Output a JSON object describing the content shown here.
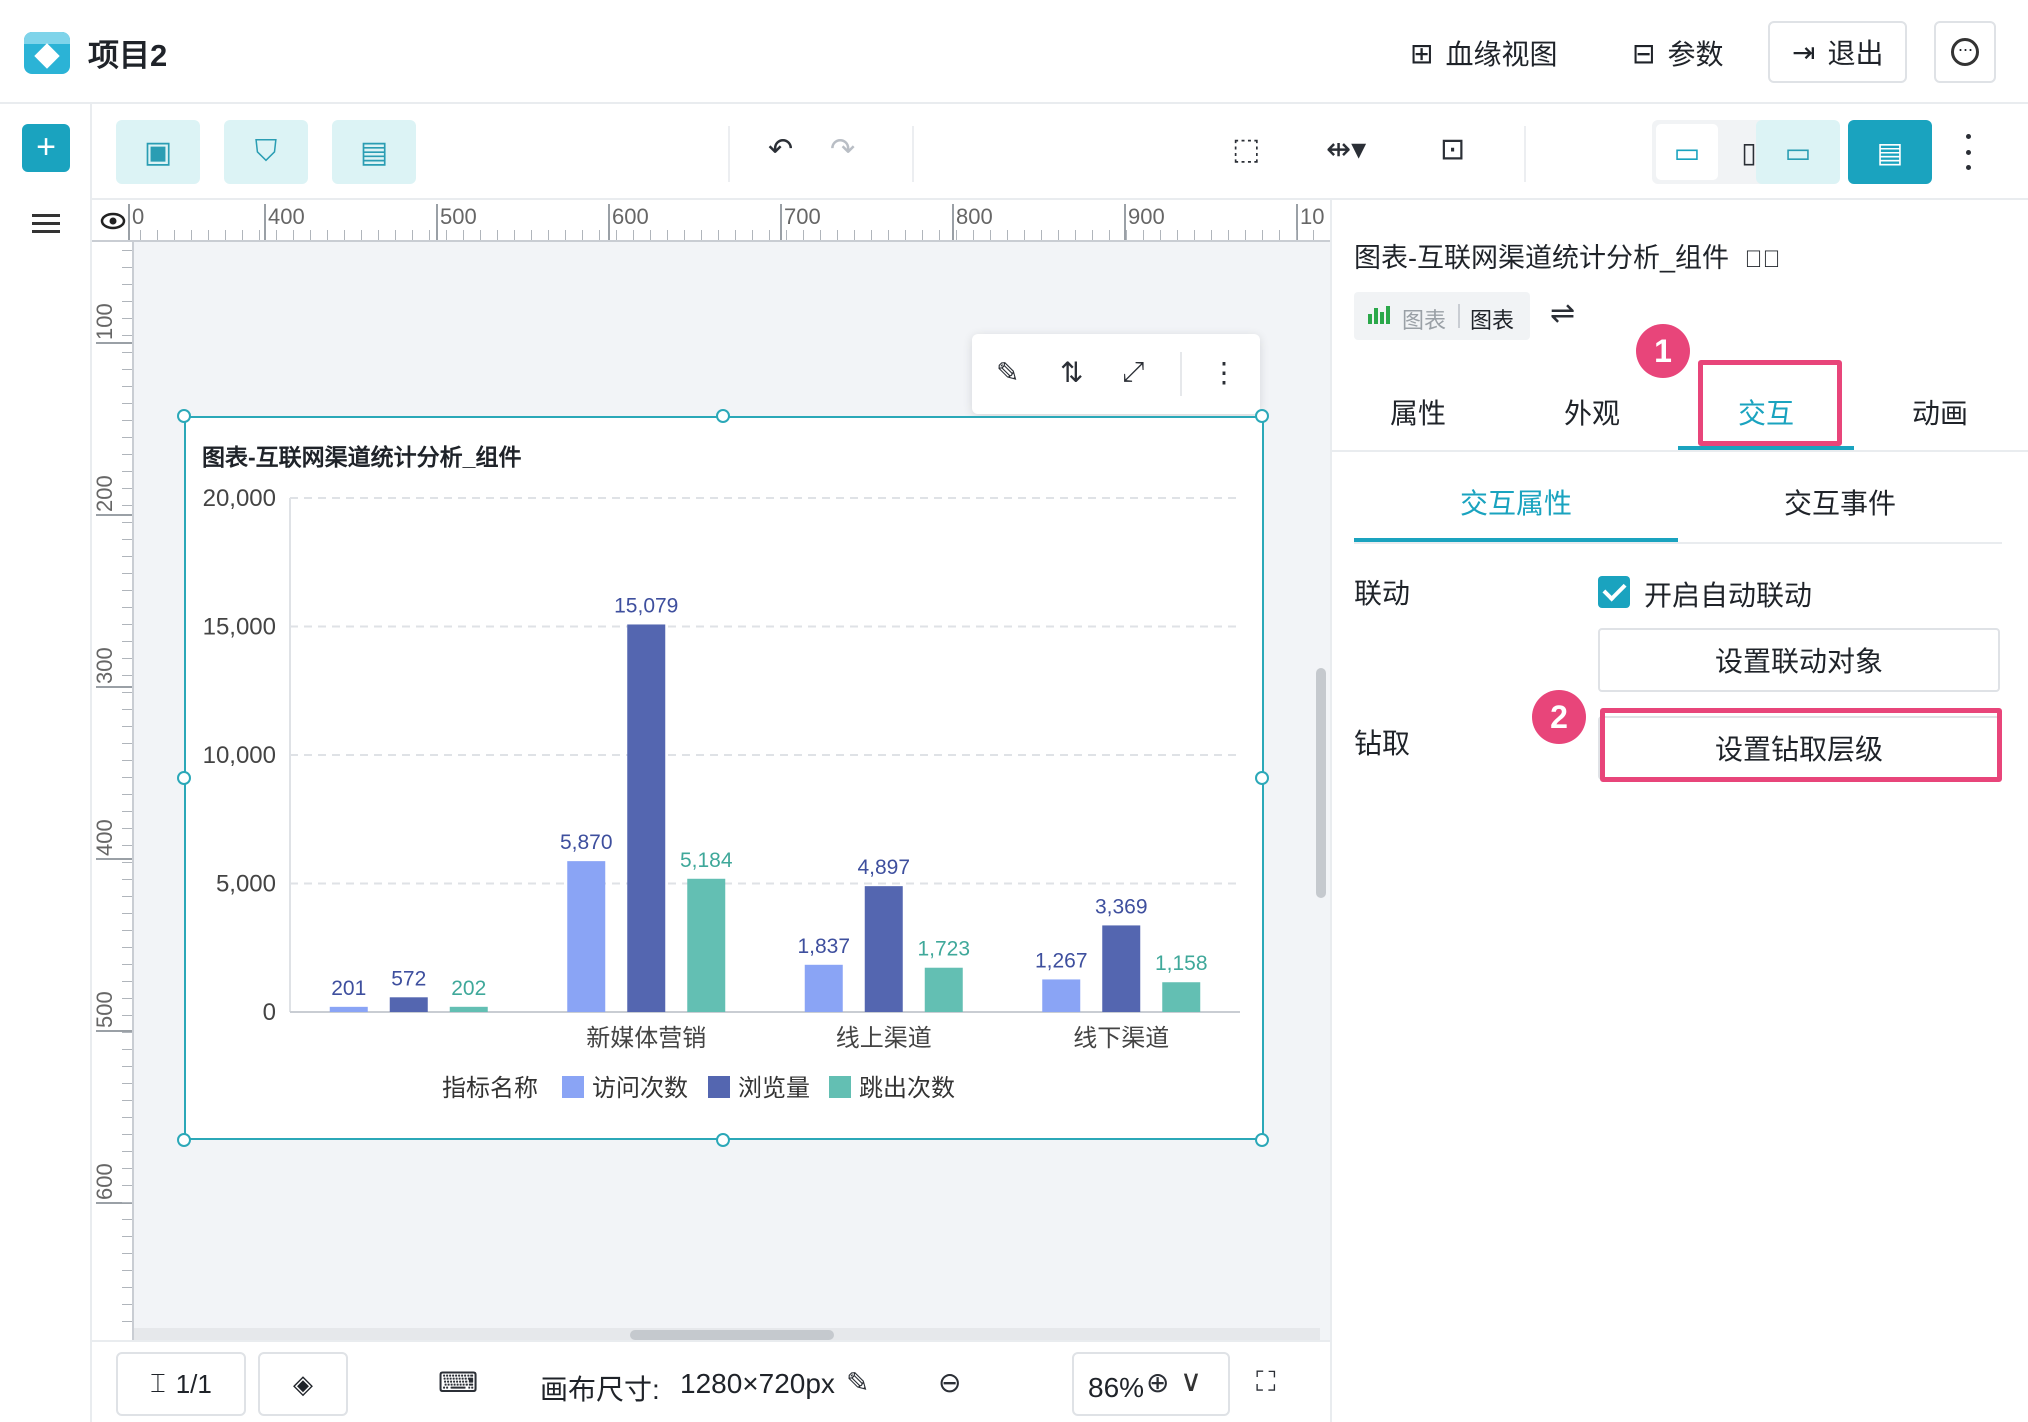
{
  "header": {
    "project_title": "项目2",
    "lineage_label": "血缘视图",
    "params_label": "参数",
    "exit_label": "退出"
  },
  "toolbar": {
    "accent_color": "#1aa3bf",
    "icons": [
      "add-chart-icon",
      "add-filter-icon",
      "add-table-icon",
      "undo-icon",
      "redo-icon",
      "select-icon",
      "align-icon",
      "layout-icon",
      "desktop-icon",
      "mobile-icon",
      "preview-icon",
      "save-icon",
      "more-icon"
    ]
  },
  "ruler": {
    "top": [
      "0",
      "400",
      "500",
      "600",
      "700",
      "800",
      "900",
      "10"
    ],
    "left": [
      "100",
      "200",
      "300",
      "400",
      "500",
      "600"
    ]
  },
  "component": {
    "title": "图表-互联网渠道统计分析_组件"
  },
  "chart_data": {
    "type": "bar",
    "title": "图表-互联网渠道统计分析_组件",
    "categories": [
      "",
      "新媒体营销",
      "线上渠道",
      "线下渠道"
    ],
    "series": [
      {
        "name": "访问次数",
        "color": "#8aa4f5",
        "values": [
          201,
          5870,
          1837,
          1267
        ]
      },
      {
        "name": "浏览量",
        "color": "#5466b0",
        "values": [
          572,
          15079,
          4897,
          3369
        ]
      },
      {
        "name": "跳出次数",
        "color": "#63bfb3",
        "values": [
          202,
          5184,
          1723,
          1158
        ]
      }
    ],
    "data_labels": [
      [
        "201",
        "5,870",
        "1,837",
        "1,267"
      ],
      [
        "572",
        "15,079",
        "4,897",
        "3,369"
      ],
      [
        "202",
        "5,184",
        "1,723",
        "1,158"
      ]
    ],
    "y_ticks": [
      "0",
      "5,000",
      "10,000",
      "15,000",
      "20,000"
    ],
    "ylim": [
      0,
      20000
    ],
    "legend_title": "指标名称",
    "legend_position": "bottom",
    "grid": true
  },
  "bottombar": {
    "page": "1/1",
    "canvas_size_label": "画布尺寸:",
    "canvas_size": "1280×720px",
    "zoom": "86%"
  },
  "panel": {
    "title": "图表-互联网渠道统计分析_组件",
    "chip_type": "图表",
    "chip_name": "图表",
    "tabs": [
      "属性",
      "外观",
      "交互",
      "动画"
    ],
    "subtabs": [
      "交互属性",
      "交互事件"
    ],
    "linkage_label": "联动",
    "auto_linkage_label": "开启自动联动",
    "set_linkage_button": "设置联动对象",
    "drill_label": "钻取",
    "set_drill_button": "设置钻取层级",
    "badges": [
      "1",
      "2"
    ],
    "highlight_color": "#e8457a"
  }
}
